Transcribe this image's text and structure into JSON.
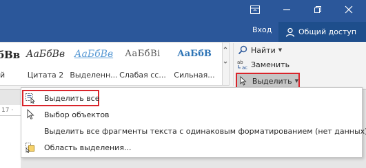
{
  "window": {
    "restore_glyph": "⊟",
    "login_label": "Вход",
    "share_label": "Общий доступ"
  },
  "styles_gallery": {
    "items": [
      {
        "sample": "бВв",
        "name": "й"
      },
      {
        "sample": "АаБбВв",
        "name": "Цитата 2"
      },
      {
        "sample": "АаБбВв",
        "name": "Выделенн..."
      },
      {
        "sample": "АаБбВі",
        "name": "Слабая сс..."
      },
      {
        "sample": "АаБбВ",
        "name": "Сильная..."
      }
    ]
  },
  "editing": {
    "find_label": "Найти",
    "replace_label": "Заменить",
    "select_label": "Выделить"
  },
  "ruler": {
    "mark": "17 ·"
  },
  "select_menu": {
    "items": [
      {
        "label": "Выделить все",
        "icon": "select-all-icon"
      },
      {
        "label": "Выбор объектов",
        "icon": "pointer-icon"
      },
      {
        "label": "Выделить все фрагменты текста с одинаковым форматированием (нет данных)",
        "icon": ""
      },
      {
        "label": "Область выделения...",
        "icon": "selection-pane-icon"
      }
    ]
  },
  "colors": {
    "titlebar": "#2b579a",
    "share_button": "#1e4e8c",
    "highlight_border": "#d9242b"
  }
}
